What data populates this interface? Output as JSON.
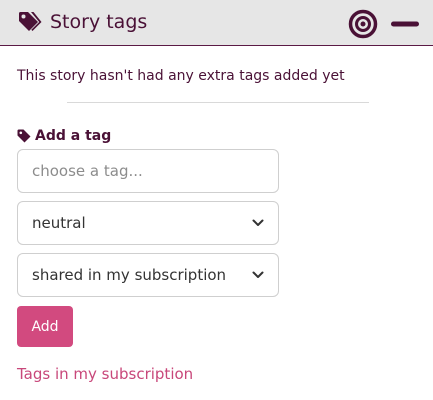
{
  "header": {
    "title": "Story tags",
    "icons": {
      "left": "tags-icon",
      "action": "target-icon",
      "window": "minimize-icon"
    }
  },
  "empty_state": {
    "message": "This story hasn't had any extra tags added yet"
  },
  "add_tag": {
    "heading": "Add a tag",
    "heading_icon": "tag-icon",
    "input_placeholder": "choose a tag...",
    "input_value": "",
    "sentiment_value": "neutral",
    "visibility_value": "shared in my subscription",
    "add_button_label": "Add"
  },
  "footer": {
    "link_label": "Tags in my subscription"
  },
  "colors": {
    "primary_text": "#4a1136",
    "header_background": "#e6e6e6",
    "button_background": "#d24a7f",
    "link": "#c8477a"
  }
}
